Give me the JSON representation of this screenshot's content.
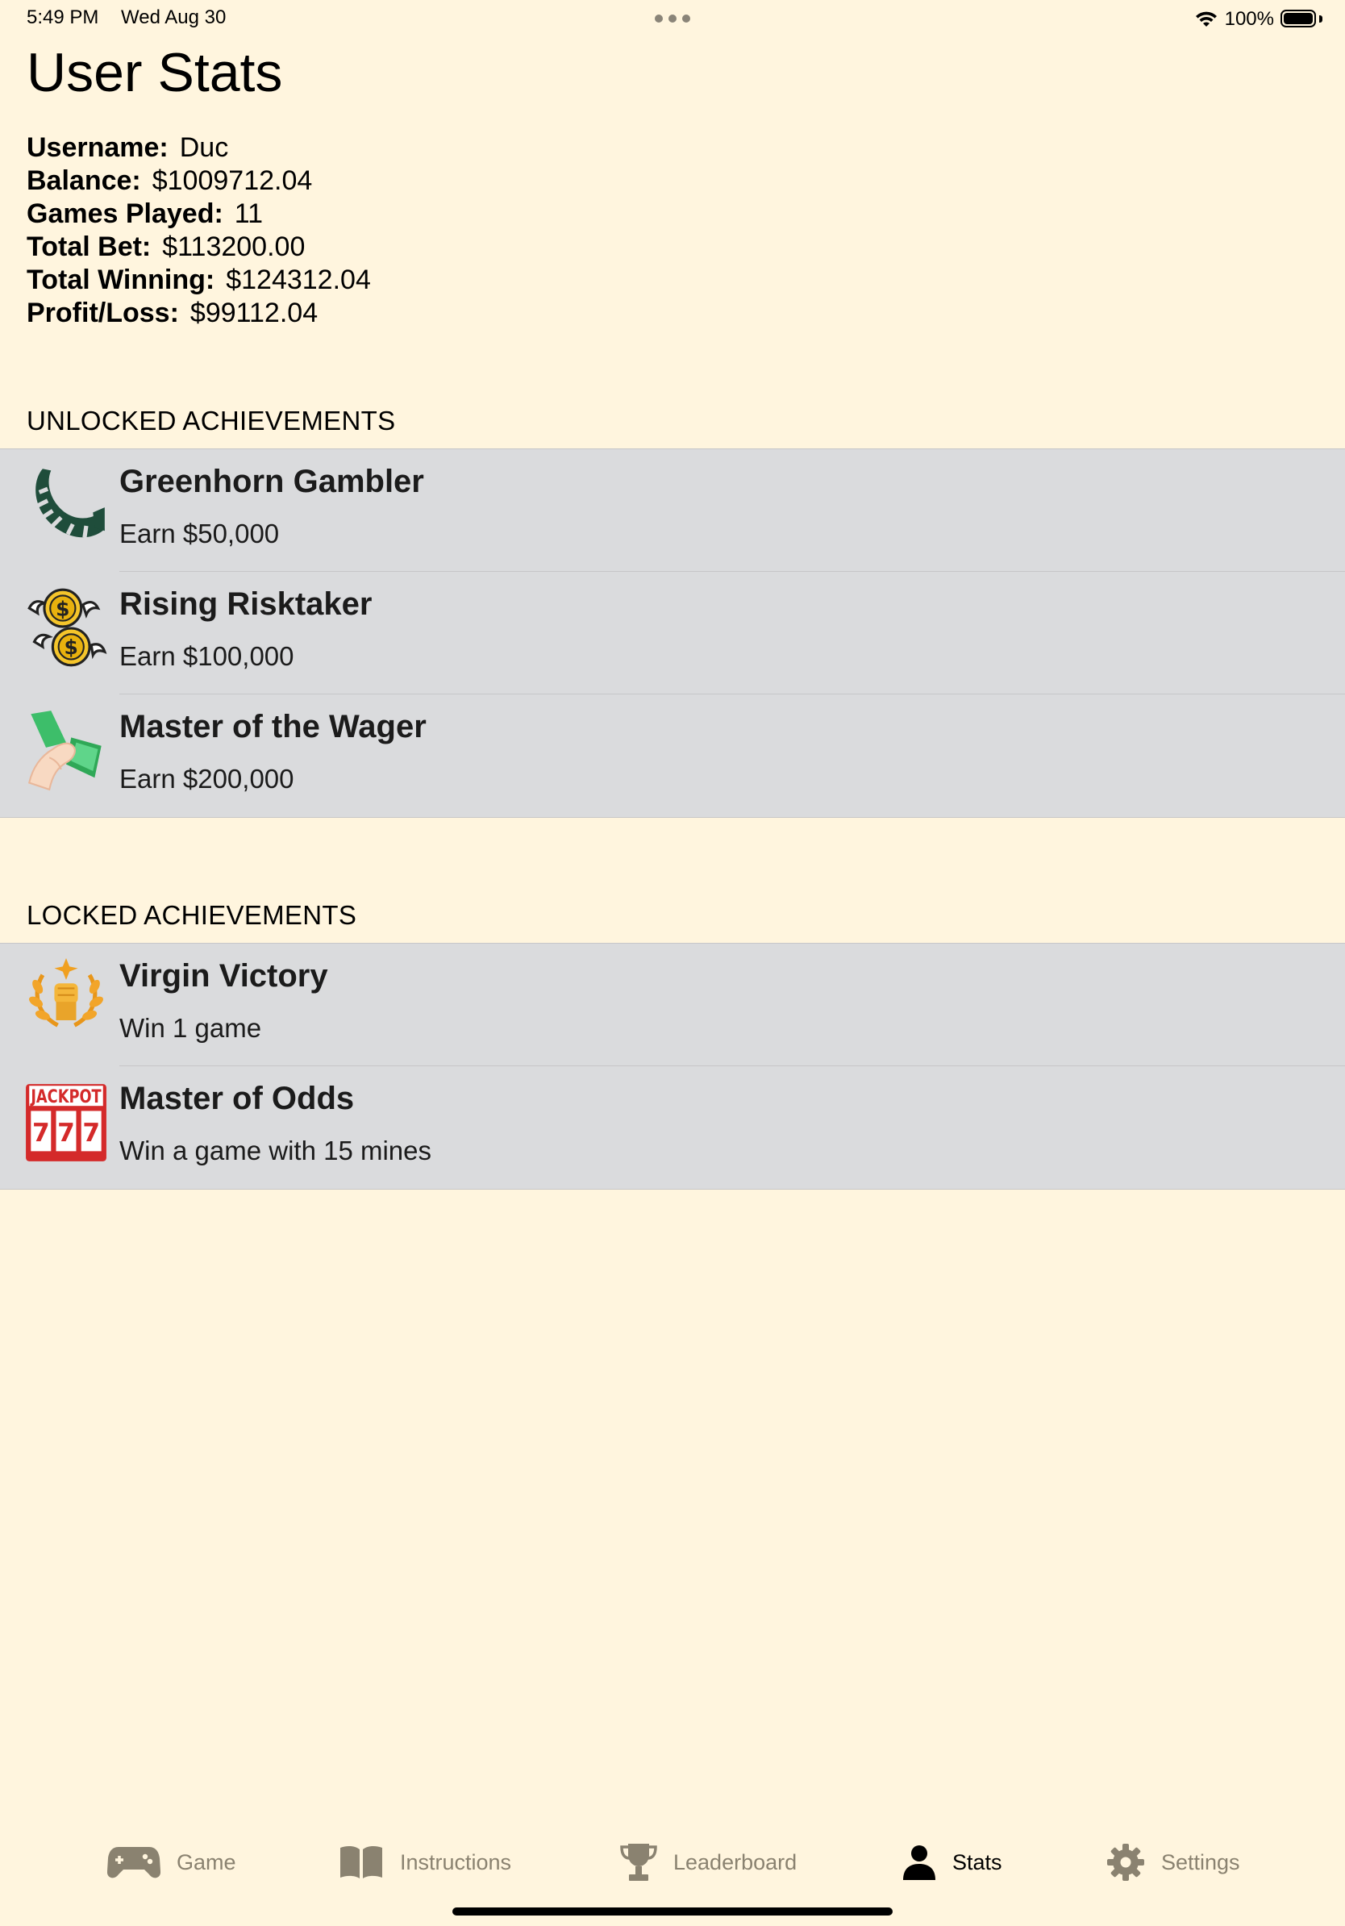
{
  "status_bar": {
    "time": "5:49 PM",
    "date": "Wed Aug 30",
    "battery": "100%"
  },
  "page_title": "User Stats",
  "stats": [
    {
      "label": "Username:",
      "value": "Duc"
    },
    {
      "label": "Balance:",
      "value": "$1009712.04"
    },
    {
      "label": "Games Played:",
      "value": "11"
    },
    {
      "label": "Total Bet:",
      "value": "$113200.00"
    },
    {
      "label": "Total Winning:",
      "value": "$124312.04"
    },
    {
      "label": "Profit/Loss:",
      "value": "$99112.04"
    }
  ],
  "unlocked": {
    "header": "UNLOCKED ACHIEVEMENTS",
    "items": [
      {
        "title": "Greenhorn Gambler",
        "desc": "Earn $50,000",
        "icon": "horn-icon"
      },
      {
        "title": "Rising Risktaker",
        "desc": "Earn $100,000",
        "icon": "flying-coins-icon"
      },
      {
        "title": "Master of the Wager",
        "desc": "Earn $200,000",
        "icon": "hand-cash-icon"
      }
    ]
  },
  "locked": {
    "header": "LOCKED ACHIEVEMENTS",
    "items": [
      {
        "title": "Virgin Victory",
        "desc": "Win 1 game",
        "icon": "laurel-fist-icon"
      },
      {
        "title": "Master of Odds",
        "desc": "Win a game with 15 mines",
        "icon": "jackpot-icon"
      }
    ]
  },
  "jackpot_text": "JACKPOT",
  "tabs": [
    {
      "label": "Game",
      "icon": "gamepad-icon"
    },
    {
      "label": "Instructions",
      "icon": "book-icon"
    },
    {
      "label": "Leaderboard",
      "icon": "trophy-icon"
    },
    {
      "label": "Stats",
      "icon": "person-icon",
      "active": true
    },
    {
      "label": "Settings",
      "icon": "gear-icon"
    }
  ],
  "colors": {
    "background": "#FFF5DE",
    "list_bg": "#DADBDD",
    "tab_inactive": "#8A8270",
    "tab_active": "#000000"
  }
}
